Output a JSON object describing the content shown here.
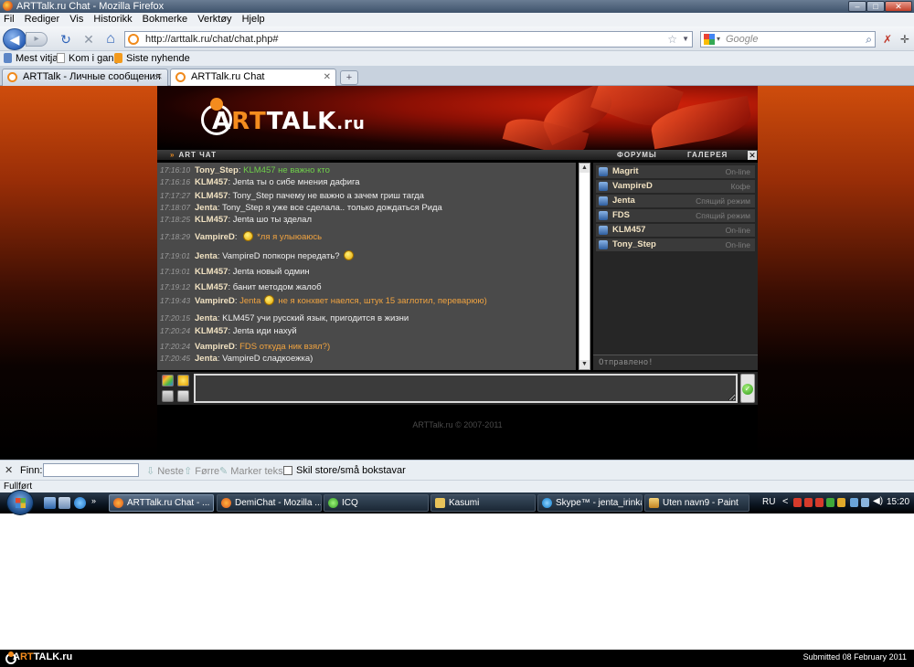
{
  "window": {
    "title": "ARTTalk.ru Chat - Mozilla Firefox",
    "minimize": "–",
    "maximize": "□",
    "close": "✕"
  },
  "menu": [
    "Fil",
    "Rediger",
    "Vis",
    "Historikk",
    "Bokmerke",
    "Verktøy",
    "Hjelp"
  ],
  "nav": {
    "back": "◀",
    "forward": "▸",
    "reload": "↻",
    "stop": "✕",
    "home": "⌂",
    "url": "http://arttalk.ru/chat/chat.php#",
    "search_placeholder": "Google"
  },
  "bookmarks": [
    "Mest vitja",
    "Kom i gang",
    "Siste nyhende"
  ],
  "tabs": [
    {
      "label": "ARTTalk - Личные сообщения",
      "active": false
    },
    {
      "label": "ARTTalk.ru Chat",
      "active": true
    }
  ],
  "newtab": "+",
  "site": {
    "logo_pre": "A",
    "logo_mid": "RT",
    "logo_post": "TALK",
    "logo_dom": ".ru",
    "chat_title": "ART ЧАТ",
    "chat_title_arrow": "»",
    "link_forums": "ФОРУМЫ",
    "link_gallery": "ГАЛЕРЕЯ",
    "close": "✕",
    "sent_status": "Отправлено!",
    "copyright": "ARTTalk.ru © 2007-2011"
  },
  "messages": [
    {
      "time": "17:16:10",
      "nick": "Tony_Step",
      "text": "KLM457 не важно кто",
      "color": "green",
      "smile": false
    },
    {
      "time": "17:16:16",
      "nick": "KLM457",
      "text": "Jenta ты о сибе мнения дафига",
      "color": "white",
      "smile": false
    },
    {
      "time": "17:17:27",
      "nick": "KLM457",
      "text": "Tony_Step пачему не важно а зачем гриш тагда",
      "color": "white",
      "smile": false
    },
    {
      "time": "17:18:07",
      "nick": "Jenta",
      "text": "Tony_Step я уже все сделала.. только дождаться Рида",
      "color": "white",
      "smile": false
    },
    {
      "time": "17:18:25",
      "nick": "KLM457",
      "text": "Jenta шо ты зделал",
      "color": "white",
      "smile": false
    },
    {
      "time": "17:18:29",
      "nick": "VampireD",
      "text": "*ля я улыюаюсь",
      "color": "orange",
      "smile": true,
      "smile_first": true
    },
    {
      "time": "17:19:01",
      "nick": "Jenta",
      "text": "VampireD попкорн передать?",
      "color": "white",
      "smile": true,
      "smile_first": false
    },
    {
      "time": "17:19:01",
      "nick": "KLM457",
      "text": "Jenta новый одмин",
      "color": "white",
      "smile": false
    },
    {
      "time": "17:19:12",
      "nick": "KLM457",
      "text": "банит методом жалоб",
      "color": "white",
      "smile": false
    },
    {
      "time": "17:19:43",
      "nick": "VampireD",
      "text": "Jenta",
      "text2": "не я конхвет наелся, штук 15 заглотил, переварюю)",
      "color": "orange",
      "smile": true,
      "smile_mid": true
    },
    {
      "time": "17:20:15",
      "nick": "Jenta",
      "text": "KLM457 учи русский язык, пригодится в жизни",
      "color": "white",
      "smile": false
    },
    {
      "time": "17:20:24",
      "nick": "KLM457",
      "text": "Jenta иди нахуй",
      "color": "white",
      "smile": false
    },
    {
      "time": "17:20:24",
      "nick": "VampireD",
      "text": "FDS откуда ник взял?)",
      "color": "orange",
      "smile": false
    },
    {
      "time": "17:20:45",
      "nick": "Jenta",
      "text": "VampireD сладкоежка)",
      "color": "white",
      "smile": false
    }
  ],
  "users": [
    {
      "name": "Magrit",
      "status": "On-line"
    },
    {
      "name": "VampireD",
      "status": "Кофе"
    },
    {
      "name": "Jenta",
      "status": "Спящий режим"
    },
    {
      "name": "FDS",
      "status": "Спящий режим"
    },
    {
      "name": "KLM457",
      "status": "On-line"
    },
    {
      "name": "Tony_Step",
      "status": "On-line"
    }
  ],
  "find": {
    "label": "Finn:",
    "next": "Neste",
    "prev": "Førre",
    "highlight": "Marker tekst",
    "case": "Skil store/små bokstavar"
  },
  "status": "Fullført",
  "taskbar": {
    "tasks": [
      "ARTTalk.ru Chat - ...",
      "DemiChat - Mozilla ...",
      "ICQ",
      "Kasumi",
      "Skype™ - jenta_irinka",
      "Uten navn9 - Paint"
    ],
    "lang": "RU",
    "chevron": "<",
    "clock": "15:20"
  },
  "footer": {
    "logo_a": "A",
    "logo_rt": "RT",
    "logo_talk": "TALK",
    "logo_ru": ".ru",
    "submitted": "Submitted 08 February 2011"
  },
  "colors": {
    "accent_orange": "#f48c1e",
    "chat_bg": "#4a4a4a",
    "nick": "#f1e2c2",
    "msg_orange": "#f0a340",
    "msg_green": "#6fcf4a"
  }
}
